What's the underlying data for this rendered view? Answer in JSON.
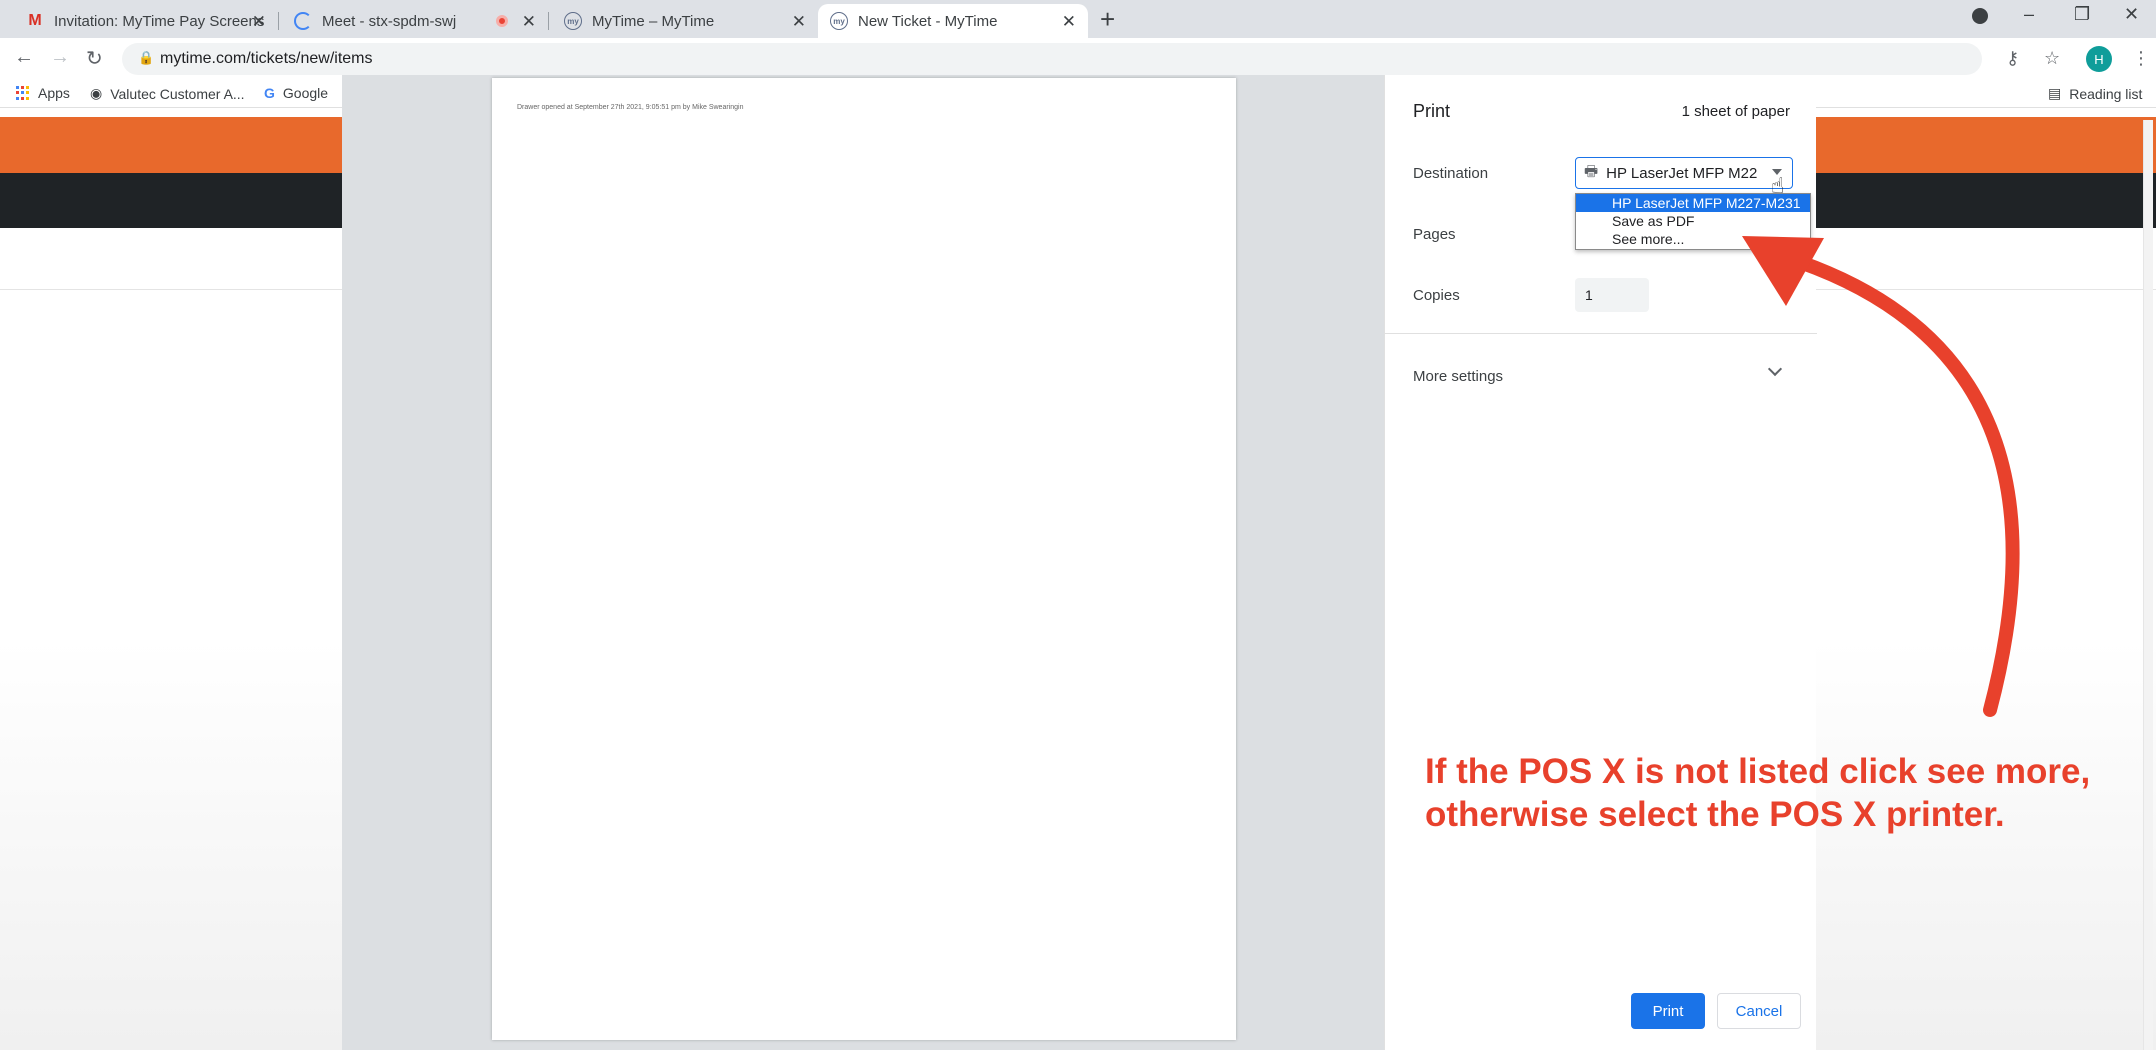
{
  "browser": {
    "tabs": [
      {
        "title": "Invitation: MyTime Pay Screensh",
        "favicon": "gmail-icon"
      },
      {
        "title": "Meet - stx-spdm-swj",
        "favicon": "meet-icon"
      },
      {
        "title": "MyTime – MyTime",
        "favicon": "mytime-icon"
      },
      {
        "title": "New Ticket - MyTime",
        "favicon": "mytime-icon",
        "active": true
      }
    ],
    "new_tab_symbol": "+",
    "url": "mytime.com/tickets/new/items",
    "profile_initial": "H",
    "bookmarks": [
      {
        "label": "Apps"
      },
      {
        "label": "Valutec Customer A..."
      },
      {
        "label": "Google"
      }
    ],
    "reading_list": "Reading list"
  },
  "print_dialog": {
    "title": "Print",
    "sheet_count": "1 sheet of paper",
    "destination_label": "Destination",
    "destination_value": "HP LaserJet MFP M22",
    "destination_options": [
      "HP LaserJet MFP M227-M231",
      "Save as PDF",
      "See more..."
    ],
    "pages_label": "Pages",
    "copies_label": "Copies",
    "copies_value": "1",
    "more_settings_label": "More settings",
    "print_button": "Print",
    "cancel_button": "Cancel",
    "preview_text": "Drawer opened at September 27th 2021, 9:05:51 pm by Mike Swearingin"
  },
  "annotation": {
    "line1": "If the POS X is not listed click see more,",
    "line2": "otherwise select the POS X printer.",
    "color": "#e8412c"
  },
  "colors": {
    "accent": "#1a73e8",
    "brand_orange": "#e8692c",
    "brand_dark": "#1f2326"
  }
}
